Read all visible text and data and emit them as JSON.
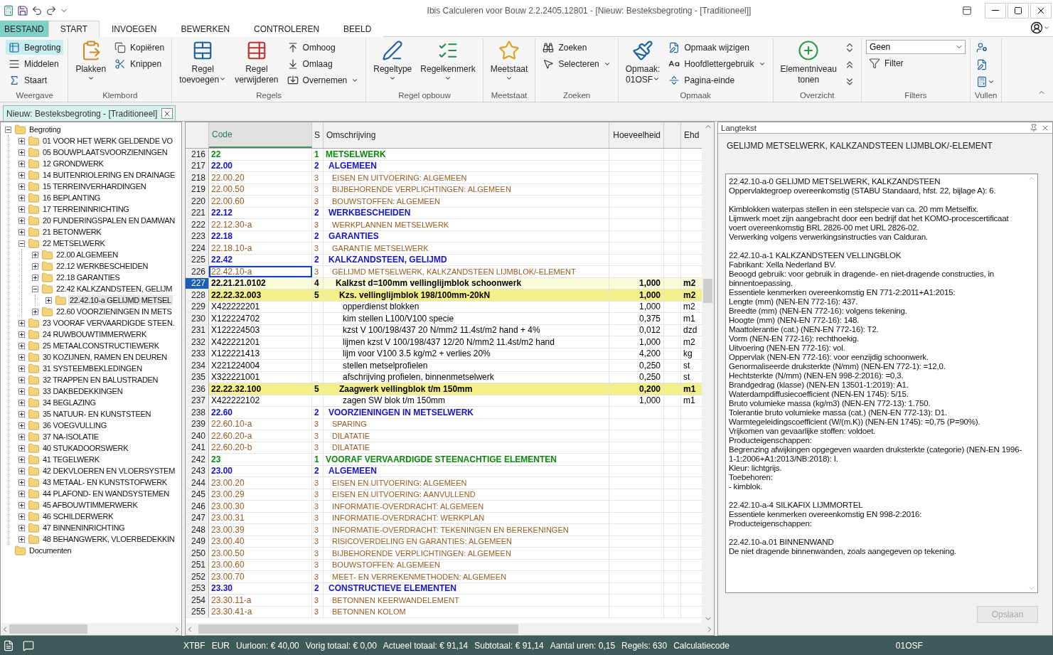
{
  "window": {
    "title": "Ibis Calculeren voor Bouw 2.2.2405.12801 - [Nieuw: Besteksbegroting - [Traditioneel]]"
  },
  "ribbon_tabs": [
    {
      "label": "BESTAND",
      "kind": "file",
      "selected": false
    },
    {
      "label": "START",
      "kind": "tab",
      "selected": true
    },
    {
      "label": "INVOEGEN",
      "kind": "tab",
      "selected": false
    },
    {
      "label": "BEWERKEN",
      "kind": "tab",
      "selected": false
    },
    {
      "label": "CONTROLEREN",
      "kind": "tab",
      "selected": false
    },
    {
      "label": "BEELD",
      "kind": "tab",
      "selected": false
    }
  ],
  "ribbon_groups": [
    {
      "label": "Weergave",
      "items": [
        {
          "kind": "small",
          "lines": [
            "Begroting"
          ],
          "selected": true,
          "dropdown": false
        },
        {
          "kind": "small",
          "lines": [
            "Middelen"
          ],
          "selected": false,
          "dropdown": false
        },
        {
          "kind": "small",
          "lines": [
            "Staart"
          ],
          "selected": false,
          "dropdown": false
        }
      ]
    },
    {
      "label": "Klembord",
      "items": [
        {
          "kind": "large",
          "lines": [
            "Plakken"
          ],
          "selected": false,
          "dropdown": true
        },
        {
          "kind": "small",
          "lines": [
            "Kopiëren"
          ],
          "selected": false,
          "dropdown": false
        },
        {
          "kind": "small",
          "lines": [
            "Knippen"
          ],
          "selected": false,
          "dropdown": false
        }
      ]
    },
    {
      "label": "Regels",
      "items": [
        {
          "kind": "large",
          "lines": [
            "Regel",
            "toevoegen"
          ],
          "selected": false,
          "dropdown": true
        },
        {
          "kind": "large",
          "lines": [
            "Regel",
            "verwijderen"
          ],
          "selected": false,
          "dropdown": false
        },
        {
          "kind": "small",
          "lines": [
            "Omhoog"
          ],
          "selected": false,
          "dropdown": false
        },
        {
          "kind": "small",
          "lines": [
            "Omlaag"
          ],
          "selected": false,
          "dropdown": false
        },
        {
          "kind": "small",
          "lines": [
            "Overnemen"
          ],
          "selected": false,
          "dropdown": true
        }
      ]
    },
    {
      "label": "Regel opbouw",
      "items": [
        {
          "kind": "large",
          "lines": [
            "Regeltype"
          ],
          "selected": false,
          "dropdown": true
        },
        {
          "kind": "large",
          "lines": [
            "Regelkenmerk"
          ],
          "selected": false,
          "dropdown": true
        }
      ]
    },
    {
      "label": "Meetstaat",
      "items": [
        {
          "kind": "large",
          "lines": [
            "Meetstaat"
          ],
          "selected": false,
          "dropdown": true
        }
      ]
    },
    {
      "label": "Zoeken",
      "items": [
        {
          "kind": "small",
          "lines": [
            "Zoeken"
          ],
          "selected": false,
          "dropdown": false
        },
        {
          "kind": "small",
          "lines": [
            "Selecteren"
          ],
          "selected": false,
          "dropdown": true
        }
      ]
    },
    {
      "label": "Opmaak",
      "items": [
        {
          "kind": "large",
          "lines": [
            "Opmaak:",
            "01OSF"
          ],
          "selected": false,
          "dropdown": true
        },
        {
          "kind": "small",
          "lines": [
            "Opmaak wijzigen"
          ],
          "selected": false,
          "dropdown": false
        },
        {
          "kind": "small",
          "lines": [
            "Hoofdlettergebruik"
          ],
          "selected": false,
          "dropdown": true
        },
        {
          "kind": "small",
          "lines": [
            "Pagina-einde"
          ],
          "selected": false,
          "dropdown": false
        }
      ]
    },
    {
      "label": "Overzicht",
      "items": [
        {
          "kind": "large",
          "lines": [
            "Elementniveau",
            "tonen"
          ],
          "selected": false,
          "dropdown": false
        },
        {
          "kind": "icon",
          "selected": false,
          "dropdown": false
        },
        {
          "kind": "icon",
          "selected": false,
          "dropdown": false
        },
        {
          "kind": "icon",
          "selected": false,
          "dropdown": false
        }
      ]
    },
    {
      "label": "Filters",
      "items": [
        {
          "kind": "combo",
          "value": "Geen",
          "selected": false,
          "dropdown": true
        },
        {
          "kind": "small",
          "lines": [
            "Filter"
          ],
          "selected": false,
          "dropdown": false
        }
      ]
    },
    {
      "label": "Vullen",
      "items": [
        {
          "kind": "icon",
          "selected": false,
          "dropdown": false
        },
        {
          "kind": "icon",
          "selected": false,
          "dropdown": false
        },
        {
          "kind": "icon",
          "selected": false,
          "dropdown": true
        }
      ]
    }
  ],
  "document_tab": {
    "label": "Nieuw: Besteksbegroting - [Traditioneel]"
  },
  "tree": [
    {
      "label": "Begroting",
      "expanded": true,
      "selected": false,
      "children": [
        {
          "label": "01 VOOR HET WERK GELDENDE VO",
          "expanded": false,
          "selected": false
        },
        {
          "label": "05 BOUWPLAATSVOORZIENINGEN",
          "expanded": false,
          "selected": false
        },
        {
          "label": "12 GRONDWERK",
          "expanded": false,
          "selected": false
        },
        {
          "label": "14 BUITENRIOLERING EN DRAINAGE",
          "expanded": false,
          "selected": false
        },
        {
          "label": "15 TERREINVERHARDINGEN",
          "expanded": false,
          "selected": false
        },
        {
          "label": "16 BEPLANTING",
          "expanded": false,
          "selected": false
        },
        {
          "label": "17 TERREININRICHTING",
          "expanded": false,
          "selected": false
        },
        {
          "label": "20 FUNDERINGSPALEN EN DAMWAN",
          "expanded": false,
          "selected": false
        },
        {
          "label": "21 BETONWERK",
          "expanded": false,
          "selected": false
        },
        {
          "label": "22 METSELWERK",
          "expanded": true,
          "selected": false,
          "children": [
            {
              "label": "22.00 ALGEMEEN",
              "expanded": false,
              "selected": false
            },
            {
              "label": "22.12 WERKBESCHEIDEN",
              "expanded": false,
              "selected": false
            },
            {
              "label": "22.18 GARANTIES",
              "expanded": false,
              "selected": false
            },
            {
              "label": "22.42 KALKZANDSTEEN, GELIJM",
              "expanded": true,
              "selected": false,
              "children": [
                {
                  "label": "22.42.10-a GELIJMD METSEL",
                  "expanded": false,
                  "selected": true
                }
              ]
            },
            {
              "label": "22.60 VOORZIENINGEN IN METS",
              "expanded": false,
              "selected": false
            }
          ]
        },
        {
          "label": "23 VOORAF VERVAARDIGDE STEEN.",
          "expanded": false,
          "selected": false
        },
        {
          "label": "24 RUWBOUWTIMMERWERK",
          "expanded": false,
          "selected": false
        },
        {
          "label": "25 METAALCONSTRUCTIEWERK",
          "expanded": false,
          "selected": false
        },
        {
          "label": "30 KOZIJNEN, RAMEN EN DEUREN",
          "expanded": false,
          "selected": false
        },
        {
          "label": "31 SYSTEEMBEKLEDINGEN",
          "expanded": false,
          "selected": false
        },
        {
          "label": "32 TRAPPEN EN BALUSTRADEN",
          "expanded": false,
          "selected": false
        },
        {
          "label": "33 DAKBEDEKKINGEN",
          "expanded": false,
          "selected": false
        },
        {
          "label": "34 BEGLAZING",
          "expanded": false,
          "selected": false
        },
        {
          "label": "35 NATUUR- EN KUNSTSTEEN",
          "expanded": false,
          "selected": false
        },
        {
          "label": "36 VOEGVULLING",
          "expanded": false,
          "selected": false
        },
        {
          "label": "37 NA-ISOLATIE",
          "expanded": false,
          "selected": false
        },
        {
          "label": "40 STUKADOORSWERK",
          "expanded": false,
          "selected": false
        },
        {
          "label": "41 TEGELWERK",
          "expanded": false,
          "selected": false
        },
        {
          "label": "42 DEKVLOEREN EN VLOERSYSTEM",
          "expanded": false,
          "selected": false
        },
        {
          "label": "43 METAAL- EN KUNSTSTOFWERK",
          "expanded": false,
          "selected": false
        },
        {
          "label": "44 PLAFOND- EN WANDSYSTEMEN",
          "expanded": false,
          "selected": false
        },
        {
          "label": "45 AFBOUWTIMMERWERK",
          "expanded": false,
          "selected": false
        },
        {
          "label": "46 SCHILDERWERK",
          "expanded": false,
          "selected": false
        },
        {
          "label": "47 BINNENINRICHTING",
          "expanded": false,
          "selected": false
        },
        {
          "label": "48 BEHANGWERK, VLOERBEDEKKIN",
          "expanded": false,
          "selected": false
        }
      ]
    },
    {
      "label": "Documenten",
      "selected": false
    }
  ],
  "table": {
    "columns": [
      "Code",
      "S",
      "Omschrijving",
      "Hoeveelheid",
      "Ehd"
    ],
    "rows": [
      {
        "nr": "216",
        "code": "22",
        "s": "1",
        "description": "METSELWERK",
        "kind": "h1",
        "selected": false,
        "focused": false
      },
      {
        "nr": "217",
        "code": "22.00",
        "s": "2",
        "description": "ALGEMEEN",
        "kind": "h2",
        "selected": false,
        "focused": false
      },
      {
        "nr": "218",
        "code": "22.00.20",
        "s": "3",
        "description": "EISEN EN UITVOERING: ALGEMEEN",
        "kind": "h3",
        "selected": false,
        "focused": false
      },
      {
        "nr": "219",
        "code": "22.00.50",
        "s": "3",
        "description": "BIJBEHORENDE VERPLICHTINGEN: ALGEMEEN",
        "kind": "h3",
        "selected": false,
        "focused": false
      },
      {
        "nr": "220",
        "code": "22.00.60",
        "s": "3",
        "description": "BOUWSTOFFEN: ALGEMEEN",
        "kind": "h3",
        "selected": false,
        "focused": false
      },
      {
        "nr": "221",
        "code": "22.12",
        "s": "2",
        "description": "WERKBESCHEIDEN",
        "kind": "h2",
        "selected": false,
        "focused": false
      },
      {
        "nr": "222",
        "code": "22.12.30-a",
        "s": "3",
        "description": "WERKPLANNEN METSELWERK",
        "kind": "h3",
        "selected": false,
        "focused": false
      },
      {
        "nr": "223",
        "code": "22.18",
        "s": "2",
        "description": "GARANTIES",
        "kind": "h2",
        "selected": false,
        "focused": false
      },
      {
        "nr": "224",
        "code": "22.18.10-a",
        "s": "3",
        "description": "GARANTIE METSELWERK",
        "kind": "h3",
        "selected": false,
        "focused": false
      },
      {
        "nr": "225",
        "code": "22.42",
        "s": "2",
        "description": "KALKZANDSTEEN, GELIJMD",
        "kind": "h2",
        "selected": false,
        "focused": false
      },
      {
        "nr": "226",
        "code": "22.42.10-a",
        "s": "3",
        "description": "GELIJMD METSELWERK, KALKZANDSTEEN LIJMBLOK/-ELEMENT",
        "kind": "h3",
        "selected": false,
        "focused": true
      },
      {
        "nr": "227",
        "code": "22.21.21.0102",
        "s": "4",
        "description": "Kalkzst d=100mm vellinglijmblok schoonwerk",
        "quantity": "1,000",
        "unit": "m2",
        "kind": "h4",
        "selected": true,
        "focused": false
      },
      {
        "nr": "228",
        "code": "22.22.32.003",
        "s": "5",
        "description": "Kzs. vellinglijmblok 198/100mm-20kN",
        "quantity": "1,000",
        "unit": "m2",
        "kind": "h5",
        "selected": false,
        "focused": false
      },
      {
        "nr": "229",
        "code": "X422222201",
        "description": "opperdienst blokken",
        "quantity": "1,000",
        "unit": "m2",
        "kind": "item",
        "selected": false,
        "focused": false
      },
      {
        "nr": "230",
        "code": "X122224702",
        "description": "kim stellen L100/V100 specie",
        "quantity": "0,375",
        "unit": "m1",
        "kind": "item",
        "selected": false,
        "focused": false
      },
      {
        "nr": "231",
        "code": "X122224503",
        "description": "kzst V 100/198/437 20 N/mm2 11.4st/m2 hand + 4%",
        "quantity": "0,012",
        "unit": "dzd",
        "kind": "item",
        "selected": false,
        "focused": false
      },
      {
        "nr": "232",
        "code": "X422221201",
        "description": "lijmen kzst V 100/198/437 12/20 N/mm2 11.4st/m2 hand",
        "quantity": "1,000",
        "unit": "m2",
        "kind": "item",
        "selected": false,
        "focused": false
      },
      {
        "nr": "233",
        "code": "X122221413",
        "description": "lijm voor V100 3.5 kg/m2 + verlies 20%",
        "quantity": "4,200",
        "unit": "kg",
        "kind": "item",
        "selected": false,
        "focused": false
      },
      {
        "nr": "234",
        "code": "X221224004",
        "description": "stellen metselprofielen",
        "quantity": "0,250",
        "unit": "st",
        "kind": "item",
        "selected": false,
        "focused": false
      },
      {
        "nr": "235",
        "code": "X322221001",
        "description": "afschrijving profielen, binnenmetselwerk",
        "quantity": "0,250",
        "unit": "st",
        "kind": "item",
        "selected": false,
        "focused": false
      },
      {
        "nr": "236",
        "code": "22.22.32.100",
        "s": "5",
        "description": "Zaagwerk vellingblok t/m 150mm",
        "quantity": "0,200",
        "unit": "m1",
        "kind": "h5",
        "selected": false,
        "focused": false
      },
      {
        "nr": "237",
        "code": "X422222102",
        "description": "zagen SW blok t/m 150mm",
        "quantity": "1,000",
        "unit": "m1",
        "kind": "item",
        "selected": false,
        "focused": false
      },
      {
        "nr": "238",
        "code": "22.60",
        "s": "2",
        "description": "VOORZIENINGEN IN METSELWERK",
        "kind": "h2",
        "selected": false,
        "focused": false
      },
      {
        "nr": "239",
        "code": "22.60.10-a",
        "s": "3",
        "description": "SPARING",
        "kind": "h3",
        "selected": false,
        "focused": false
      },
      {
        "nr": "240",
        "code": "22.60.20-a",
        "s": "3",
        "description": "DILATATIE",
        "kind": "h3",
        "selected": false,
        "focused": false
      },
      {
        "nr": "241",
        "code": "22.60.20-b",
        "s": "3",
        "description": "DILATATIE",
        "kind": "h3",
        "selected": false,
        "focused": false
      },
      {
        "nr": "242",
        "code": "23",
        "s": "1",
        "description": "VOORAF VERVAARDIGDE STEENACHTIGE ELEMENTEN",
        "kind": "h1",
        "selected": false,
        "focused": false
      },
      {
        "nr": "243",
        "code": "23.00",
        "s": "2",
        "description": "ALGEMEEN",
        "kind": "h2",
        "selected": false,
        "focused": false
      },
      {
        "nr": "244",
        "code": "23.00.20",
        "s": "3",
        "description": "EISEN EN UITVOERING: ALGEMEEN",
        "kind": "h3",
        "selected": false,
        "focused": false
      },
      {
        "nr": "245",
        "code": "23.00.29",
        "s": "3",
        "description": "EISEN EN UITVOERING: AANVULLEND",
        "kind": "h3",
        "selected": false,
        "focused": false
      },
      {
        "nr": "246",
        "code": "23.00.30",
        "s": "3",
        "description": "INFORMATIE-OVERDRACHT: ALGEMEEN",
        "kind": "h3",
        "selected": false,
        "focused": false
      },
      {
        "nr": "247",
        "code": "23.00.31",
        "s": "3",
        "description": "INFORMATIE-OVERDRACHT: WERKPLAN",
        "kind": "h3",
        "selected": false,
        "focused": false
      },
      {
        "nr": "248",
        "code": "23.00.39",
        "s": "3",
        "description": "INFORMATIE-OVERDRACHT: TEKENINGEN EN BEREKENINGEN",
        "kind": "h3",
        "selected": false,
        "focused": false
      },
      {
        "nr": "249",
        "code": "23.00.40",
        "s": "3",
        "description": "RISICOVERDELING EN GARANTIES: ALGEMEEN",
        "kind": "h3",
        "selected": false,
        "focused": false
      },
      {
        "nr": "250",
        "code": "23.00.50",
        "s": "3",
        "description": "BIJBEHORENDE VERPLICHTINGEN: ALGEMEEN",
        "kind": "h3",
        "selected": false,
        "focused": false
      },
      {
        "nr": "251",
        "code": "23.00.60",
        "s": "3",
        "description": "BOUWSTOFFEN: ALGEMEEN",
        "kind": "h3",
        "selected": false,
        "focused": false
      },
      {
        "nr": "252",
        "code": "23.00.70",
        "s": "3",
        "description": "MEET- EN VERREKENMETHODEN: ALGEMEEN",
        "kind": "h3",
        "selected": false,
        "focused": false
      },
      {
        "nr": "253",
        "code": "23.30",
        "s": "2",
        "description": "CONSTRUCTIEVE ELEMENTEN",
        "kind": "h2",
        "selected": false,
        "focused": false
      },
      {
        "nr": "254",
        "code": "23.30.11-a",
        "s": "3",
        "description": "BETONNEN KEERWANDELEMENT",
        "kind": "h3",
        "selected": false,
        "focused": false
      },
      {
        "nr": "255",
        "code": "23.30.41-a",
        "s": "3",
        "description": "BETONNEN KOLOM",
        "kind": "h3",
        "selected": false,
        "focused": false
      }
    ]
  },
  "langtekst": {
    "title": "Langtekst",
    "heading": "GELIJMD METSELWERK, KALKZANDSTEEN LIJMBLOK/-ELEMENT",
    "paragraphs": [
      [
        "22.42.10-a-0 GELIJMD METSELWERK, KALKZANDSTEEN",
        "Oppervlaktegroep overeenkomstig (STABU Standaard, hfst. 22, bijlage A): 6."
      ],
      [
        "Kimblokken waterpas stellen in een stelspecie van ca. 20 mm Metselfix.",
        "Lijmwerk moet zijn aangebracht door een bedrijf dat het KOMO-procescertificaat voert overeenkomstig BRL 2826-00 met URL 2826-02.",
        "Verwerking volgens verwerkingsinstructies van Calduran."
      ],
      [
        "22.42.10-a-1 KALKZANDSTEEN VELLINGBLOK",
        "Fabrikant: Xella Nederland BV.",
        "Beoogd gebruik: voor gebruik in dragende- en niet-dragende constructies, in binnentoepassing.",
        "Essentiele kenmerken overeenkomstig EN 771-2:2011+A1:2015:",
        "Lengte (mm) (NEN-EN 772-16): 437.",
        "Breedte (mm) (NEN-EN 772-16): volgens tekening.",
        "Hoogte (mm) (NEN-EN 772-16): 148.",
        "Maattolerantie (cat.) (NEN-EN 772-16): T2.",
        "Vorm (NEN-EN 772-16): rechthoekig.",
        "Uitvoering (NEN-EN 772-16): vol.",
        "Oppervlak (NEN-EN 772-16): voor eenzijdig schoonwerk.",
        "Genormaliseerde druksterkte (N/mm) (NEN-EN 772-1): =12,0.",
        "Hechtsterkte (N/mm) (NEN-EN 998-2:2016): =0,3.",
        "Brandgedrag (klasse) (NEN-EN 13501-1:2019): A1.",
        "Waterdampdiffusiecoefficient (NEN-EN 1745): 5/15.",
        "Bruto volumieke massa (kg/m3) (NEN-EN 772-13): 1.750.",
        "Tolerantie bruto volumieke massa (cat.) (NEN-EN 772-13): D1.",
        "Warmtegeleidingscoefficient (W/(m.K)) (NEN-EN 1745): =0,75 (P=90%).",
        "Vrijkomen van gevaarlijke stoffen: voldoet.",
        "Producteigenschappen:",
        "Begrenzing afwijkingen opgegeven waarden druksterkte (categorie) (NEN-EN 1996-1-1:2006+A1:2013/NB:2018): I.",
        "Kleur: lichtgrijs.",
        "Toebehoren:",
        "- kimblok."
      ],
      [
        "22.42.10-a-4 SILKAFIX LIJMMORTEL",
        "Essentiele kenmerken overeenkomstig EN 998-2:2016:",
        "Producteigenschappen:"
      ],
      [
        "22.42.10-a.01 BINNENWAND",
        "De niet dragende binnenwanden, zoals aangegeven op tekening."
      ]
    ],
    "save_button": {
      "label": "Opslaan",
      "disabled": true
    }
  },
  "status_bar": [
    "XTBF",
    "EUR",
    "Uurloon: € 40,00",
    "Vorig totaal: € 0,00",
    "Actueel totaal: € 91,14",
    "Subtotaal: € 91,14",
    "Aantal uren: 0,15",
    "Regels: 630",
    "Calculatiecode",
    "01OSF"
  ]
}
